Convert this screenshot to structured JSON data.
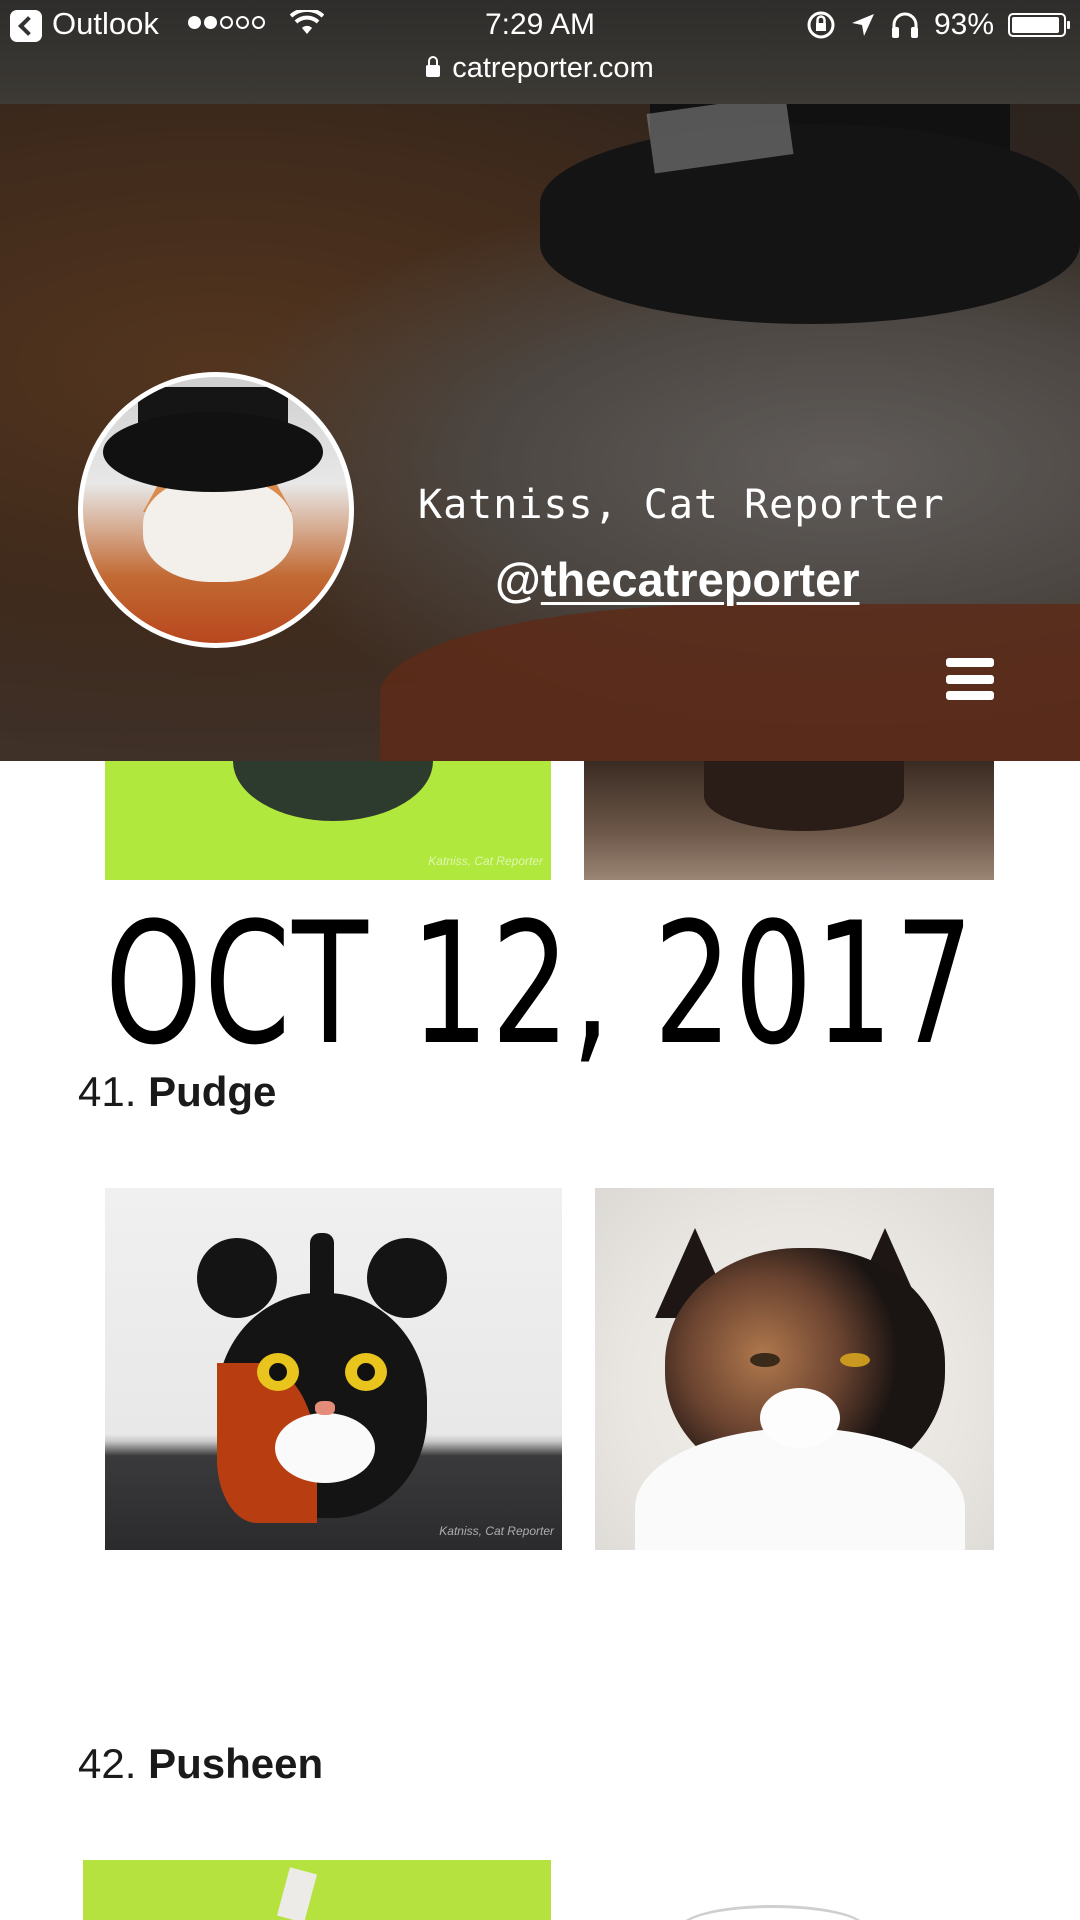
{
  "status_bar": {
    "back_app": "Outlook",
    "time": "7:29 AM",
    "battery": "93%",
    "battery_level": 0.93,
    "url": "catreporter.com",
    "signal_bars": 2
  },
  "header": {
    "name": "Katniss, Cat Reporter",
    "handle_prefix": "@",
    "handle": "thecatreporter"
  },
  "images": {
    "watermark": "Katniss, Cat Reporter"
  },
  "content": {
    "date_heading": "OCT 12, 2017",
    "entries": [
      {
        "number": "41.",
        "name": "Pudge"
      },
      {
        "number": "42.",
        "name": "Pusheen"
      }
    ]
  }
}
